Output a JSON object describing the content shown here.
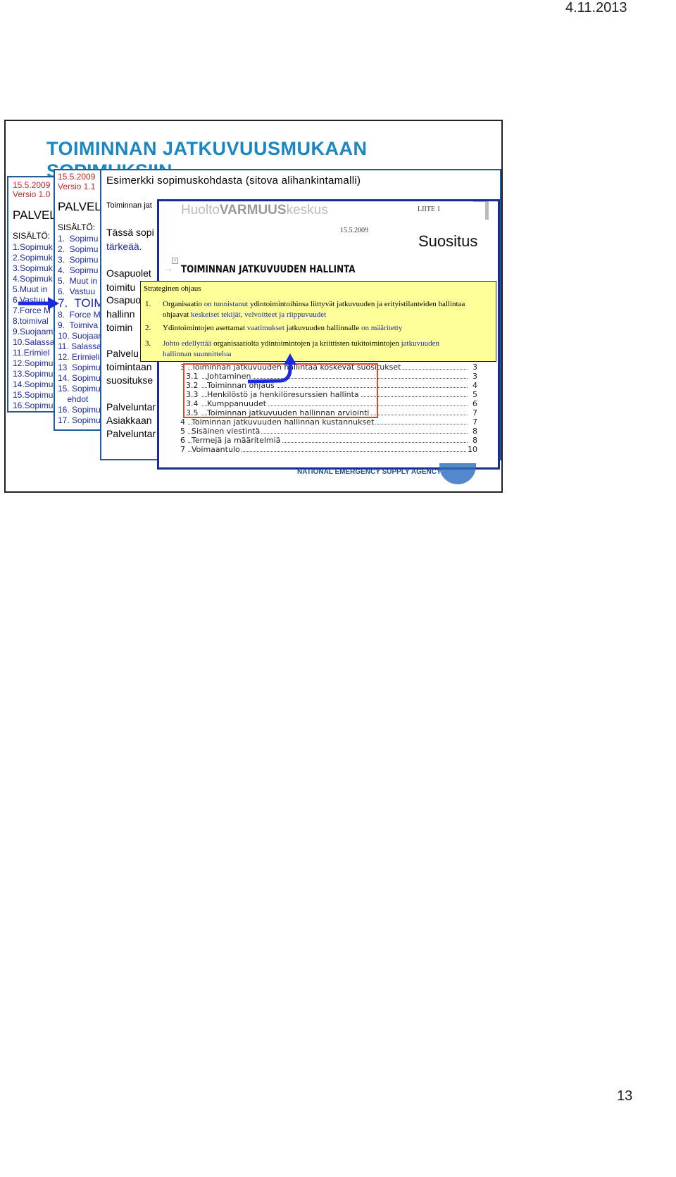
{
  "header": {
    "date": "4.11.2013"
  },
  "footer": {
    "page_number": "13"
  },
  "slide": {
    "title_line1": "TOIMINNAN JATKUVUUSMUKAAN",
    "title_line2": "SOPIMUKSIIN",
    "panel1": {
      "date": "15.5.2009",
      "version": "Versio 1.0",
      "heading": "PALVEL",
      "contents_label": "SISÄLTÖ:",
      "items": [
        "1.Sopimuk",
        "2.Sopimuk",
        "3.Sopimuk",
        "4.Sopimuk",
        "5.Muut in",
        "6.Vastuu",
        "7.Force M",
        "8.toimival",
        "9.Suojaam",
        "10.Salassa",
        "11.Erimiel",
        "12.Sopimu",
        "13.Sopimu",
        "14.Sopimu",
        "15.Sopimu",
        "16.Sopimu"
      ]
    },
    "panel2": {
      "date": "15.5.2009",
      "version": "Versio 1.1",
      "heading": "PALVELU",
      "contents_label": "SISÄLTÖ:",
      "items": [
        "1.  Sopimu",
        "2.  Sopimu",
        "3.  Sopimu",
        "4.  Sopimu",
        "5.  Muut in",
        "6.  Vastuu",
        "7.  TOIM",
        "8.  Force M",
        "9.  Toimiva",
        "10. Suojaan",
        "11. Salassa",
        "12. Erimieli",
        "13  Sopimu",
        "14. Sopimu",
        "15. Sopimu",
        "    ehdot",
        "16. Sopimu",
        "17. Sopimu"
      ]
    },
    "panel3": {
      "heading": "Esimerkki sopimuskohdasta (sitova alihankintamalli)",
      "small_line": "Toiminnan jat",
      "lines": [
        "Tässä sopi",
        "tärkeää.",
        "Osapuolet",
        "toimitu",
        "Osapuo",
        "hallinn",
        "toimin",
        "Palvelu",
        "toimintaan",
        "suositukse",
        "Palveluntar",
        "Asiakkaan",
        "Palveluntar"
      ]
    },
    "document": {
      "logo_text_a": "Huolto",
      "logo_text_b": "VARMUUS",
      "logo_text_c": "keskus",
      "annex": "LIITE 1",
      "date": "15.5.2009",
      "doc_type": "Suositus",
      "section_title": "TOIMINNAN JATKUVUUDEN HALLINTA",
      "toc": [
        {
          "num": "3",
          "title": "Toiminnan jatkuvuuden hallintaa koskevat suositukset",
          "page": "3",
          "sub": false
        },
        {
          "num": "3.1",
          "title": "Johtaminen",
          "page": "3",
          "sub": true
        },
        {
          "num": "3.2",
          "title": "Toiminnan ohjaus",
          "page": "4",
          "sub": true
        },
        {
          "num": "3.3",
          "title": "Henkilöstö ja henkilöresurssien hallinta",
          "page": "5",
          "sub": true
        },
        {
          "num": "3.4",
          "title": "Kumppanuudet",
          "page": "6",
          "sub": true
        },
        {
          "num": "3.5",
          "title": "Toiminnan jatkuvuuden hallinnan arviointi",
          "page": "7",
          "sub": true
        },
        {
          "num": "4",
          "title": "Toiminnan jatkuvuuden hallinnan kustannukset",
          "page": "7",
          "sub": false
        },
        {
          "num": "5",
          "title": "Sisäinen viestintä",
          "page": "8",
          "sub": false
        },
        {
          "num": "6",
          "title": "Termejä ja määritelmiä",
          "page": "8",
          "sub": false
        },
        {
          "num": "7",
          "title": "Voimaantulo",
          "page": "10",
          "sub": false
        }
      ],
      "agency": "NATIONAL EMERGENCY SUPPLY AGENCY"
    },
    "callout": {
      "title": "Strateginen ohjaus",
      "items": [
        {
          "num": "1.",
          "parts": [
            [
              "Organisaatio ",
              false
            ],
            [
              "on tunnistanut",
              true
            ],
            [
              " ydintoimintoihinsa liittyvät jatkuvuuden ja erityistilanteiden hallintaa",
              false
            ]
          ],
          "parts2": [
            [
              "ohjaavat ",
              false
            ],
            [
              "keskeiset tekijät, velvoitteet ja riippuvuudet",
              true
            ]
          ]
        },
        {
          "num": "2.",
          "parts": [
            [
              "Ydintoimintojen asettamat ",
              false
            ],
            [
              "vaatimukset",
              true
            ],
            [
              " jatkuvuuden hallinnalle ",
              false
            ],
            [
              "on määritetty",
              true
            ]
          ]
        },
        {
          "num": "3.",
          "parts": [
            [
              "Johto edellyttää",
              true
            ],
            [
              " organisaatiolta ydintoimintojen ja kriittisten tukitoimintojen ",
              false
            ],
            [
              "jatkuvuuden",
              true
            ]
          ],
          "parts2": [
            [
              "hallinnan suunnittelua",
              true
            ]
          ]
        }
      ]
    },
    "colors": {
      "title": "#1a87c5",
      "panel_border": "#1f5b99",
      "doc_border": "#1b2a9a",
      "callout_bg": "#ffff99",
      "highlight_box": "#e0442a",
      "arrow": "#1a2ae0",
      "date_red": "#c0282c"
    }
  }
}
